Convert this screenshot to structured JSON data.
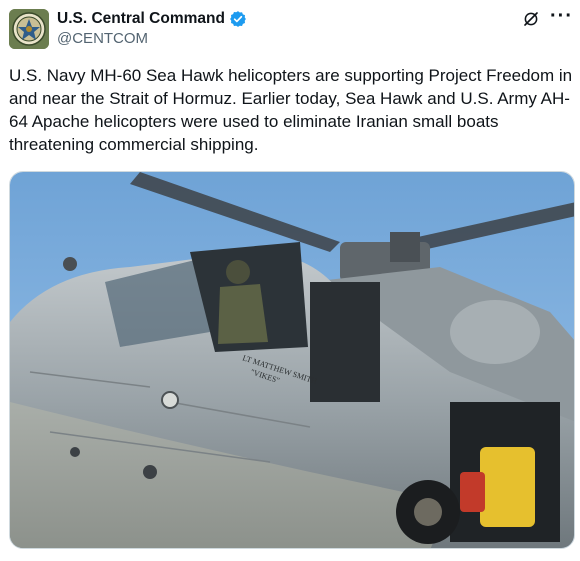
{
  "author": {
    "display_name": "U.S. Central Command",
    "handle": "@CENTCOM",
    "verified": true,
    "avatar_icon": "centcom-seal-icon"
  },
  "actions": {
    "grok_icon": "grok-icon",
    "more_label": "···"
  },
  "post": {
    "text": "U.S. Navy MH-60 Sea Hawk helicopters are supporting Project Freedom in and near the Strait of Hormuz. Earlier today, Sea Hawk and U.S. Army AH-64 Apache helicopters were used to eliminate Iranian small boats threatening commercial shipping."
  },
  "media": {
    "subject": "helicopter-photo",
    "nameplate_line1": "LT MATTHEW SMITH",
    "nameplate_line2": "\"VIKES\""
  },
  "colors": {
    "sky": "#7fb0e0",
    "fuselage": "#9aa3a8",
    "verified_blue": "#1d9bf0",
    "avatar_bg": "#6b7d4f"
  }
}
